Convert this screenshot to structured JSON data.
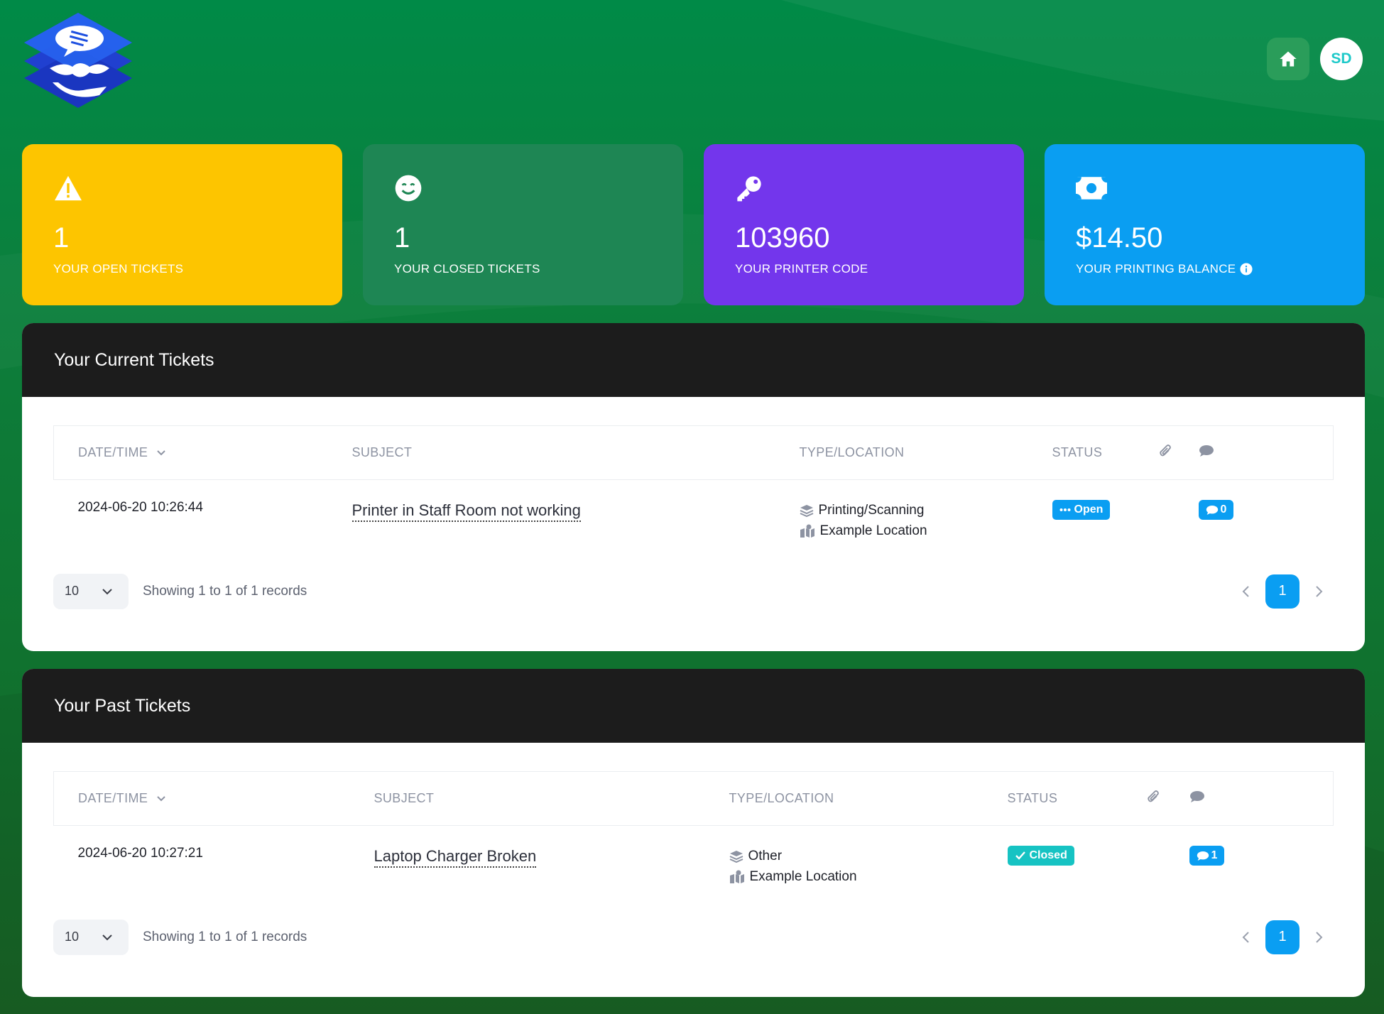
{
  "header": {
    "avatar_initials": "SD",
    "home_icon": "home-icon"
  },
  "cards": [
    {
      "value": "1",
      "label": "YOUR OPEN TICKETS",
      "icon": "warning-icon",
      "color": "#fdc500"
    },
    {
      "value": "1",
      "label": "YOUR CLOSED TICKETS",
      "icon": "smile-icon",
      "color": "#1e8654"
    },
    {
      "value": "103960",
      "label": "YOUR PRINTER CODE",
      "icon": "key-icon",
      "color": "#7336ec"
    },
    {
      "value": "$14.50",
      "label": "YOUR PRINTING BALANCE",
      "icon": "money-icon",
      "color": "#0a9ef2"
    }
  ],
  "current": {
    "title": "Your Current Tickets",
    "columns": {
      "datetime": "DATE/TIME",
      "subject": "SUBJECT",
      "type_location": "TYPE/LOCATION",
      "status": "STATUS"
    },
    "rows": [
      {
        "datetime": "2024-06-20 10:26:44",
        "subject": "Printer in Staff Room not working",
        "type": "Printing/Scanning",
        "location": "Example Location",
        "status": "Open",
        "comments": "0"
      }
    ],
    "page_size": "10",
    "showing": "Showing 1 to 1 of 1 records",
    "page": "1"
  },
  "past": {
    "title": "Your Past Tickets",
    "columns": {
      "datetime": "DATE/TIME",
      "subject": "SUBJECT",
      "type_location": "TYPE/LOCATION",
      "status": "STATUS"
    },
    "rows": [
      {
        "datetime": "2024-06-20 10:27:21",
        "subject": "Laptop Charger Broken",
        "type": "Other",
        "location": "Example Location",
        "status": "Closed",
        "comments": "1"
      }
    ],
    "page_size": "10",
    "showing": "Showing 1 to 1 of 1 records",
    "page": "1"
  },
  "colors": {
    "accent": "#0a9ef2",
    "panel_header": "#1c1c1c",
    "closed": "#16c3c3"
  }
}
